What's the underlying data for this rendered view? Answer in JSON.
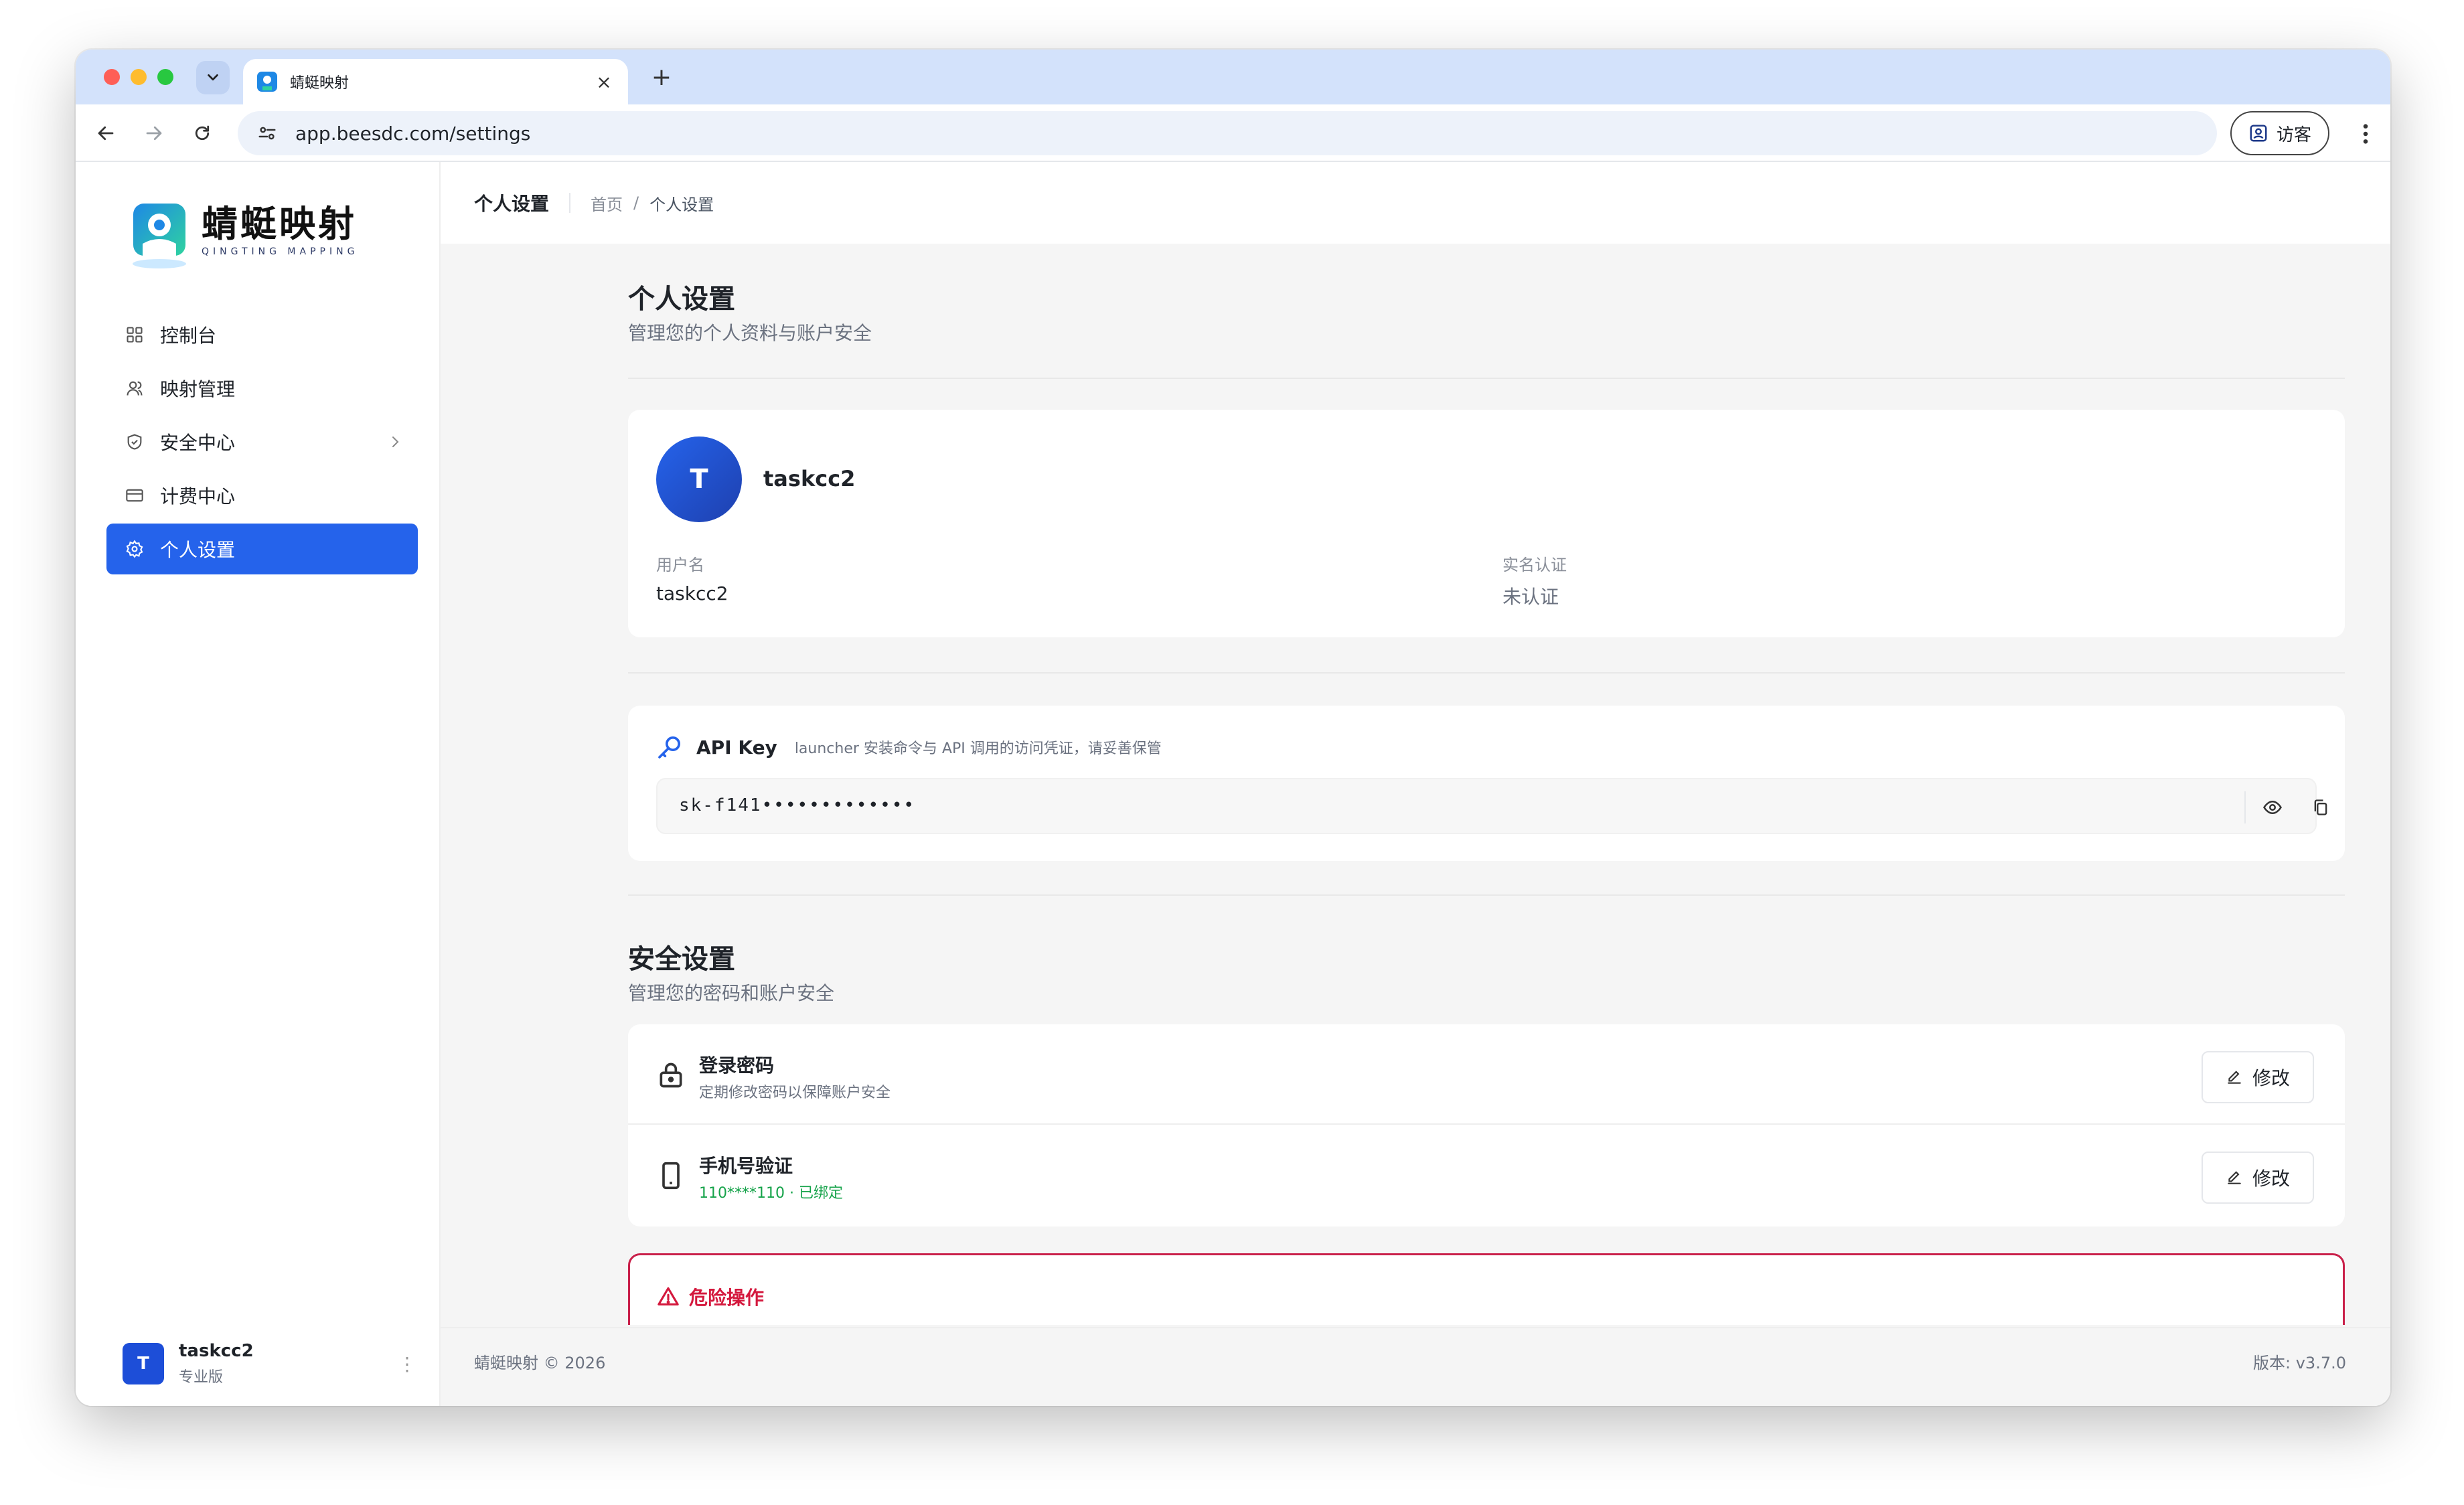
{
  "browser": {
    "tab_title": "蜻蜓映射",
    "tab_close": "×",
    "new_tab": "+",
    "url": "app.beesdc.com/settings",
    "guest_label": "访客"
  },
  "app": {
    "logo_cn": "蜻蜓映射",
    "logo_en": "QINGTING MAPPING",
    "brand_color": "#2563eb"
  },
  "sidebar": {
    "items": [
      {
        "label": "控制台",
        "icon": "grid-icon"
      },
      {
        "label": "映射管理",
        "icon": "users-icon"
      },
      {
        "label": "安全中心",
        "icon": "shield-icon"
      },
      {
        "label": "计费中心",
        "icon": "card-icon"
      },
      {
        "label": "个人设置",
        "icon": "gear-icon",
        "active": true
      }
    ],
    "user": {
      "initial": "T",
      "name": "taskcc2",
      "plan": "专业版",
      "more": "⋮"
    }
  },
  "topbar": {
    "title": "个人设置",
    "breadcrumb": [
      "首页",
      "个人设置"
    ],
    "breadcrumb_sep": "/"
  },
  "profile": {
    "section_title": "个人设置",
    "section_subtitle": "管理您的个人资料与账户安全",
    "avatar_initial": "T",
    "name": "taskcc2",
    "username_label": "用户名",
    "username_value": "taskcc2",
    "verify_label": "实名认证",
    "verify_value": "未认证"
  },
  "apikey": {
    "title": "API Key",
    "description": "launcher 安装命令与 API 调用的访问凭证，请妥善保管",
    "value": "sk-f141•••••••••••••"
  },
  "security": {
    "section_title": "安全设置",
    "section_subtitle": "管理您的密码和账户安全",
    "rows": [
      {
        "title": "登录密码",
        "desc": "定期修改密码以保障账户安全",
        "button": "修改"
      },
      {
        "title": "手机号验证",
        "desc": "110****110 · 已绑定",
        "button": "修改"
      }
    ]
  },
  "danger": {
    "title": "危险操作",
    "color": "#d4183d"
  },
  "footer": {
    "copyright": "蜻蜓映射 © 2026",
    "version": "版本: v3.7.0"
  }
}
